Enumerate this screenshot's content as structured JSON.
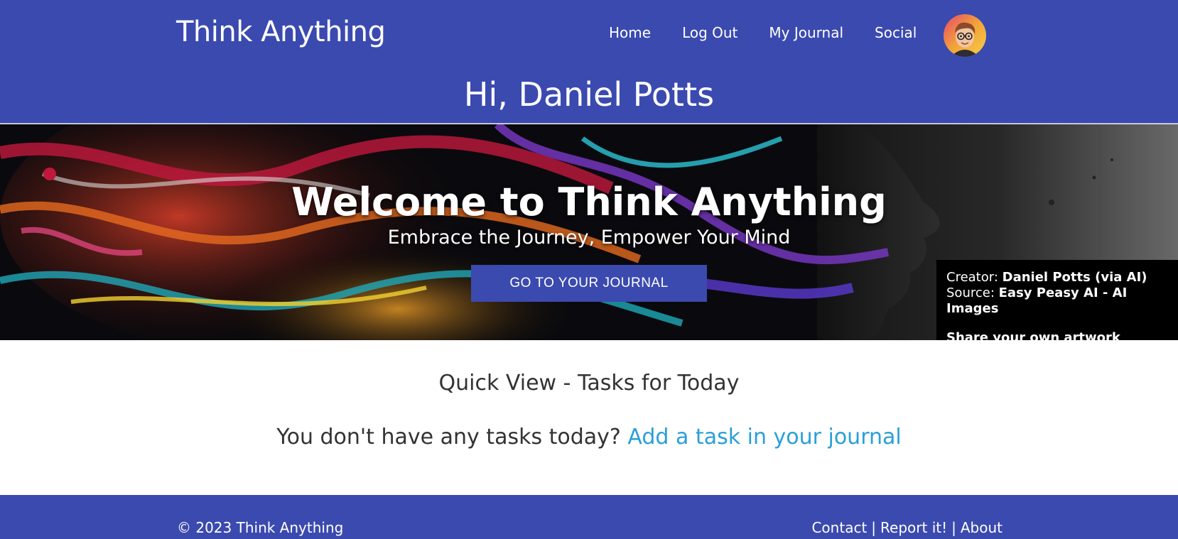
{
  "header": {
    "brand": "Think Anything",
    "nav": {
      "home": "Home",
      "logout": "Log Out",
      "journal": "My Journal",
      "social": "Social"
    },
    "greeting": "Hi, Daniel Potts"
  },
  "hero": {
    "title": "Welcome to Think Anything",
    "subtitle": "Embrace the Journey, Empower Your Mind",
    "button": "GO TO YOUR JOURNAL",
    "credit": {
      "creator_label": "Creator:",
      "creator": "Daniel Potts (via AI)",
      "source_label": "Source:",
      "source": "Easy Peasy AI - AI Images",
      "share": "Share your own artwork"
    }
  },
  "quick_view": {
    "title": "Quick View - Tasks for Today",
    "empty_text": "You don't have any tasks today?",
    "add_link": "Add a task in your journal"
  },
  "footer": {
    "copyright": "© 2023 Think Anything",
    "contact": "Contact",
    "report": "Report it!",
    "about": "About",
    "separator": "|"
  },
  "colors": {
    "primary": "#3b4aaf",
    "link": "#2a9fd8",
    "text": "#333333"
  }
}
